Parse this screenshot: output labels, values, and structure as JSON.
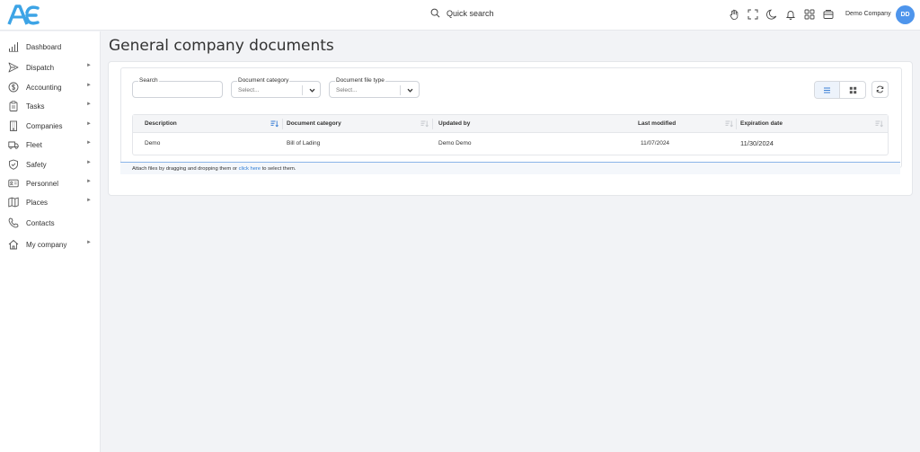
{
  "app": {
    "logo_text": "AE"
  },
  "header": {
    "search_label": "Quick search",
    "company_name": "Demo Company",
    "avatar_initials": "DD",
    "icons": [
      "hand-icon",
      "fullscreen-icon",
      "moon-icon",
      "bell-icon",
      "apps-grid-icon",
      "card-icon"
    ]
  },
  "sidebar": {
    "items": [
      {
        "label": "Dashboard",
        "icon": "bar-chart-icon",
        "has_submenu": false
      },
      {
        "label": "Dispatch",
        "icon": "send-icon",
        "has_submenu": true
      },
      {
        "label": "Accounting",
        "icon": "dollar-circle-icon",
        "has_submenu": true
      },
      {
        "label": "Tasks",
        "icon": "clipboard-icon",
        "has_submenu": true
      },
      {
        "label": "Companies",
        "icon": "building-icon",
        "has_submenu": true
      },
      {
        "label": "Fleet",
        "icon": "truck-icon",
        "has_submenu": true
      },
      {
        "label": "Safety",
        "icon": "shield-check-icon",
        "has_submenu": true
      },
      {
        "label": "Personnel",
        "icon": "id-card-icon",
        "has_submenu": true
      },
      {
        "label": "Places",
        "icon": "map-icon",
        "has_submenu": true
      },
      {
        "label": "Contacts",
        "icon": "phone-icon",
        "has_submenu": false
      },
      {
        "label": "My company",
        "icon": "home-icon",
        "has_submenu": true
      }
    ],
    "submenu_arrow": "►"
  },
  "page": {
    "title": "General company documents"
  },
  "filters": {
    "search": {
      "label": "Search",
      "value": ""
    },
    "category": {
      "label": "Document category",
      "placeholder": "Select..."
    },
    "file_type": {
      "label": "Document file type",
      "placeholder": "Select..."
    }
  },
  "table": {
    "columns": [
      "Description",
      "Document category",
      "Updated by",
      "Last modified",
      "Expiration date"
    ],
    "rows": [
      {
        "description": "Demo",
        "category": "Bill of Lading",
        "updated_by": "Demo Demo",
        "last_modified": "11/07/2024",
        "expiration_date": "11/30/2024"
      }
    ],
    "active_sort_column": "Description"
  },
  "dropzone": {
    "text_before": "Attach files by dragging and dropping them or ",
    "link_text": "click here",
    "text_after": " to select them."
  },
  "colors": {
    "accent": "#4e95ec",
    "link": "#2f7dd6",
    "logo": "#3da4e6"
  }
}
